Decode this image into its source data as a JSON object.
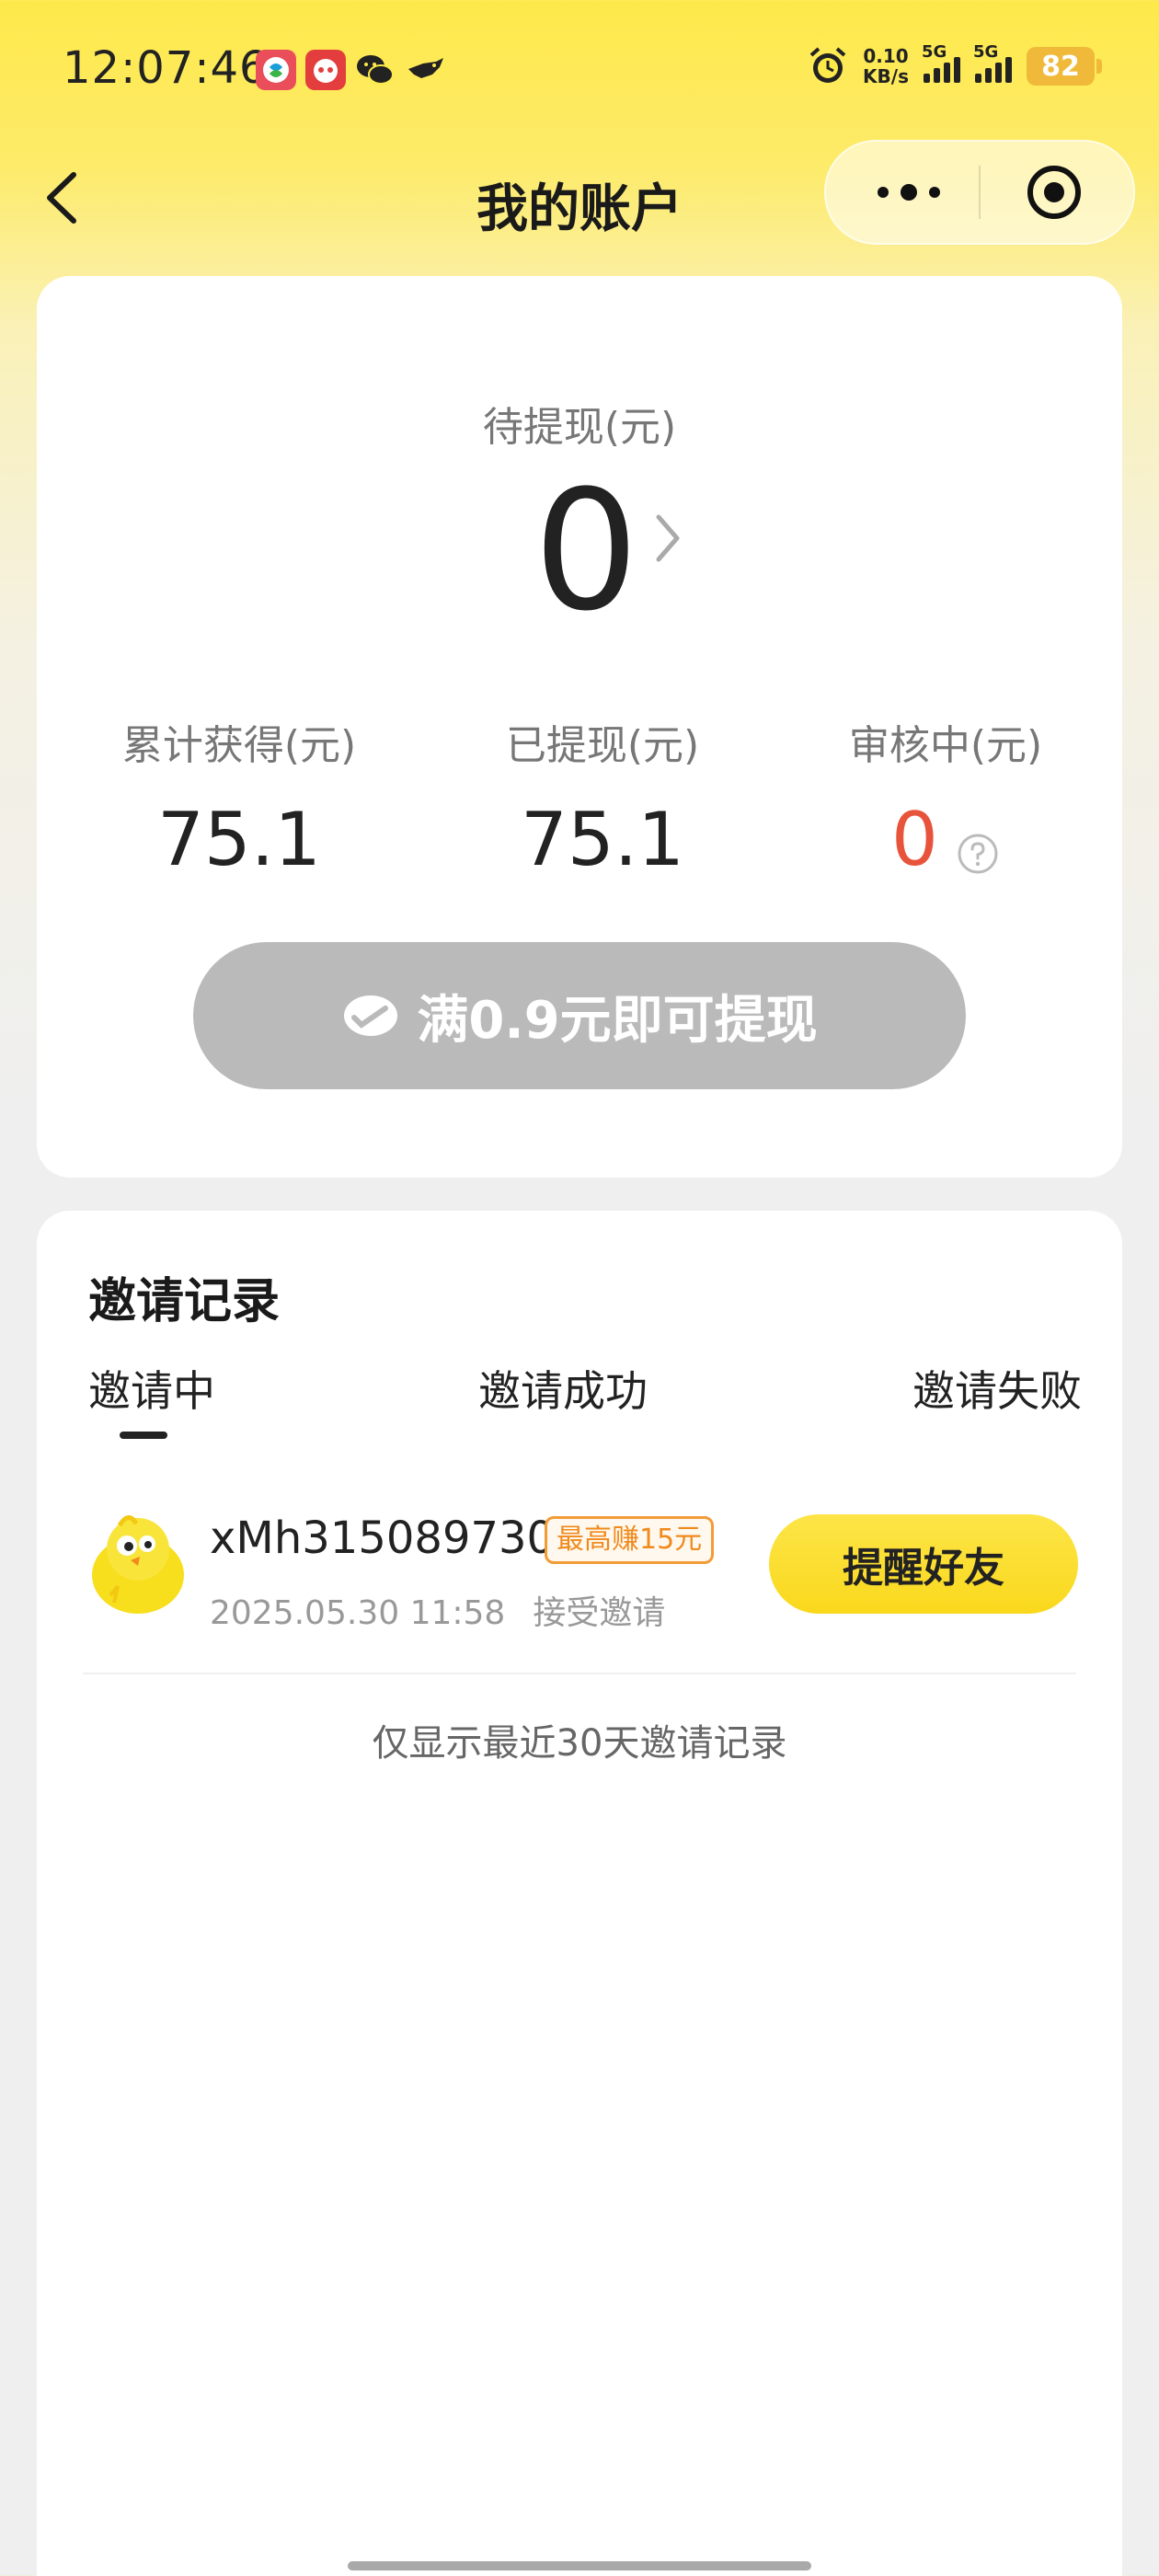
{
  "status_bar": {
    "time": "12:07:46",
    "net_speed_value": "0.10",
    "net_speed_unit": "KB/s",
    "signal1_label": "5G",
    "signal2_label": "5G",
    "battery": "82",
    "app_icons": [
      "app-icon-1",
      "app-icon-2",
      "wechat-icon",
      "bird-icon"
    ]
  },
  "nav": {
    "title": "我的账户",
    "back_icon": "chevron-left-icon",
    "more_icon": "more-dots-icon",
    "close_icon": "target-circle-icon"
  },
  "account": {
    "pending_label": "待提现(元)",
    "pending_value": "0",
    "stats": [
      {
        "label": "累计获得(元)",
        "value": "75.1"
      },
      {
        "label": "已提现(元)",
        "value": "75.1"
      },
      {
        "label": "审核中(元)",
        "value": "0"
      }
    ],
    "withdraw_button": "满0.9元即可提现",
    "colors": {
      "review_value": "#e8543b",
      "button_disabled": "#bababa"
    }
  },
  "invite": {
    "title": "邀请记录",
    "tabs": [
      "邀请中",
      "邀请成功",
      "邀请失败"
    ],
    "active_tab": "邀请中",
    "records": [
      {
        "username": "xMh315089730",
        "badge": "最高赚15元",
        "date": "2025.05.30 11:58",
        "status": "接受邀请",
        "action": "提醒好友"
      }
    ],
    "footnote": "仅显示最近30天邀请记录",
    "colors": {
      "action_button": "#fde548",
      "badge": "#f08a1c"
    }
  }
}
